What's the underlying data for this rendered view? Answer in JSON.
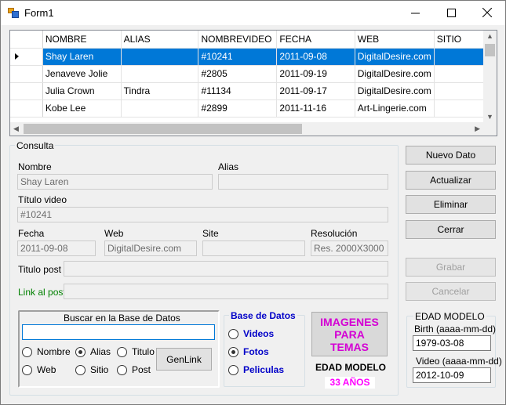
{
  "window": {
    "title": "Form1"
  },
  "grid": {
    "columns": [
      "NOMBRE",
      "ALIAS",
      "NOMBREVIDEO",
      "FECHA",
      "WEB",
      "SITIO"
    ],
    "rows": [
      {
        "selected": true,
        "cells": [
          "Shay Laren",
          "",
          "#10241",
          "2011-09-08",
          "DigitalDesire.com",
          ""
        ]
      },
      {
        "selected": false,
        "cells": [
          "Jenaveve Jolie",
          "",
          "#2805",
          "2011-09-19",
          "DigitalDesire.com",
          ""
        ]
      },
      {
        "selected": false,
        "cells": [
          "Julia Crown",
          "Tindra",
          "#11134",
          "2011-09-17",
          "DigitalDesire.com",
          ""
        ]
      },
      {
        "selected": false,
        "cells": [
          "Kobe Lee",
          "",
          "#2899",
          "2011-11-16",
          "Art-Lingerie.com",
          ""
        ]
      }
    ]
  },
  "consulta": {
    "title": "Consulta",
    "nombre_label": "Nombre",
    "nombre_value": "Shay Laren",
    "alias_label": "Alias",
    "alias_value": "",
    "titulo_label": "Título video",
    "titulo_value": "#10241",
    "fecha_label": "Fecha",
    "fecha_value": "2011-09-08",
    "web_label": "Web",
    "web_value": "DigitalDesire.com",
    "site_label": "Site",
    "site_value": "",
    "resolucion_label": "Resolución",
    "resolucion_value": "Res. 2000X3000",
    "titulo_post_label": "Titulo post",
    "titulo_post_value": "",
    "link_post_label": "Link al post",
    "link_post_value": ""
  },
  "buscar": {
    "title": "Buscar en la Base de Datos",
    "input_value": "",
    "radios": [
      "Nombre",
      "Alias",
      "Titulo",
      "Web",
      "Sitio",
      "Post"
    ],
    "selected": "Alias",
    "genlink_label": "GenLink"
  },
  "basedatos": {
    "title": "Base de Datos",
    "options": [
      "Videos",
      "Fotos",
      "Peliculas"
    ],
    "selected": "Fotos"
  },
  "imagenes_button": "IMAGENES PARA TEMAS",
  "edad_modelo_label": "EDAD MODELO",
  "edad_value": "33 AÑOS",
  "buttons": {
    "nuevo": "Nuevo Dato",
    "actualizar": "Actualizar",
    "eliminar": "Eliminar",
    "cerrar": "Cerrar",
    "grabar": "Grabar",
    "cancelar": "Cancelar"
  },
  "edad_group": {
    "title": "EDAD MODELO",
    "birth_label": "Birth (aaaa-mm-dd)",
    "birth_value": "1979-03-08",
    "video_label": "Video (aaaa-mm-dd)",
    "video_value": "2012-10-09"
  },
  "colors": {
    "selection": "#0078d7",
    "link_label": "#008000",
    "blue_bold": "#0000c8",
    "imagenes_text": "#d400d4",
    "edad_text": "#ff00ff",
    "imagenes_bg": "#d9d9d9"
  }
}
